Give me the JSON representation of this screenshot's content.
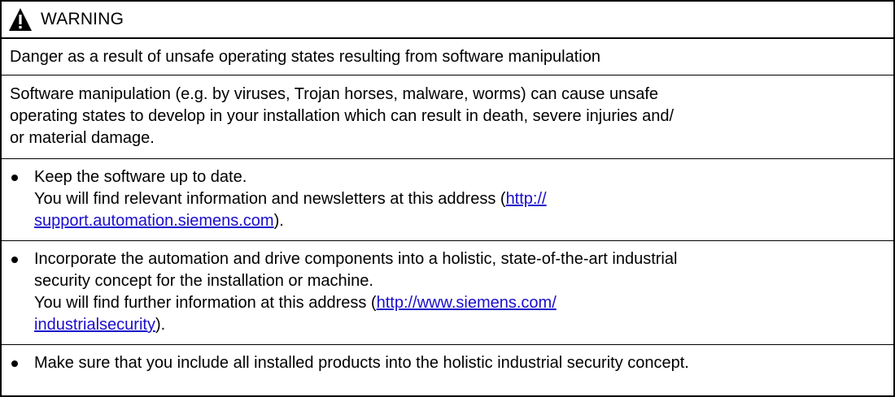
{
  "header": {
    "title": "WARNING",
    "icon": "warning-triangle-icon"
  },
  "headline": "Danger as a result of unsafe operating states resulting from software manipulation",
  "description": {
    "line1": "Software manipulation (e.g. by viruses, Trojan horses, malware, worms) can cause unsafe",
    "line2": "operating states to develop in your installation which can result in death, severe injuries and/",
    "line3": "or material damage."
  },
  "bullets": [
    {
      "line1": "Keep the software up to date.",
      "line2_prefix": "You will find relevant information and newsletters at this address (",
      "link_part1": "http://",
      "link_part2": "support.automation.siemens.com",
      "line3_suffix": ")."
    },
    {
      "line1": "Incorporate the automation and drive components into a holistic, state-of-the-art industrial",
      "line2": "security concept for the installation or machine.",
      "line3_prefix": "You will find further information at this address (",
      "link_part1": "http://www.siemens.com/",
      "link_part2": "industrialsecurity",
      "line4_suffix": ")."
    },
    {
      "line1": "Make sure that you include all installed products into the holistic industrial security concept."
    }
  ],
  "colors": {
    "link": "#1a0dcc",
    "border": "#000000"
  }
}
